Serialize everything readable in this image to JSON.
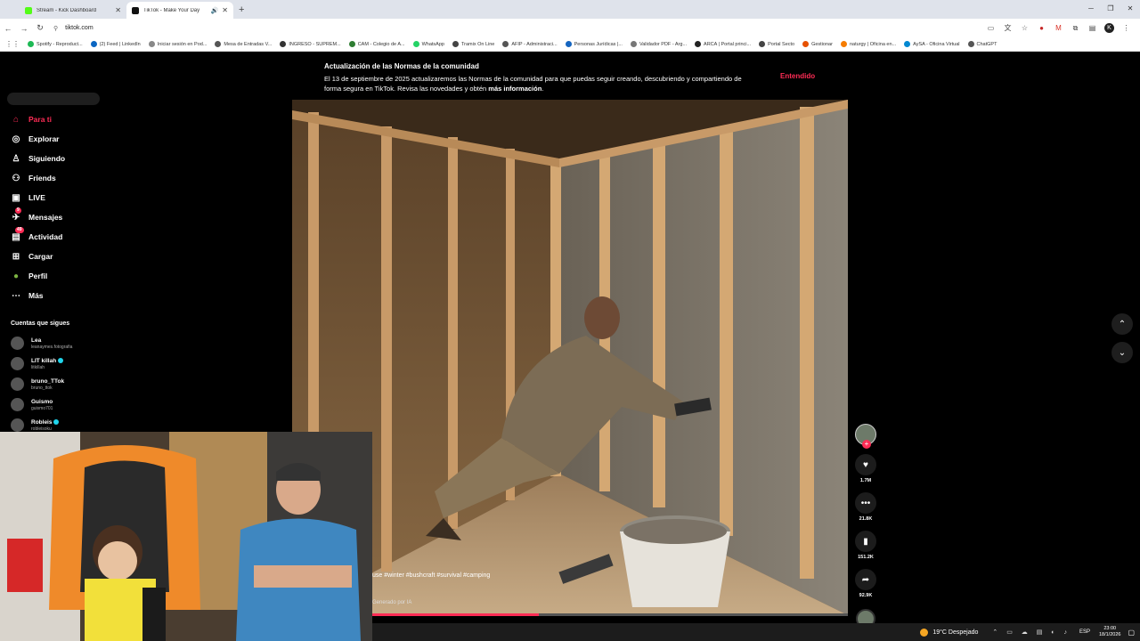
{
  "browser": {
    "tabs": [
      {
        "title": "Stream - Kick Dashboard",
        "active": false,
        "favicon_color": "#53fc18"
      },
      {
        "title": "TikTok - Make Your Day",
        "active": true,
        "favicon_color": "#111111"
      }
    ],
    "url": "tiktok.com",
    "bookmarks": [
      {
        "label": "Spotify - Reproduct...",
        "color": "#1db954"
      },
      {
        "label": "(2) Feed | LinkedIn",
        "color": "#0a66c2"
      },
      {
        "label": "Iniciar sesión en Pod...",
        "color": "#888888"
      },
      {
        "label": "Mesa de Entradas V...",
        "color": "#555555"
      },
      {
        "label": "INGRESO - SUPREM...",
        "color": "#333333"
      },
      {
        "label": "CAM - Colegio de A...",
        "color": "#2e7d32"
      },
      {
        "label": "WhatsApp",
        "color": "#25d366"
      },
      {
        "label": "Tramix On Line",
        "color": "#444444"
      },
      {
        "label": "AFIP - Administraci...",
        "color": "#555555"
      },
      {
        "label": "Personas Jurídicas |...",
        "color": "#1565c0"
      },
      {
        "label": "Validador PDF - Arg...",
        "color": "#777777"
      },
      {
        "label": "ARCA | Portal princi...",
        "color": "#222222"
      },
      {
        "label": "Portal Secto",
        "color": "#444444"
      },
      {
        "label": "Gestionar",
        "color": "#e65100"
      },
      {
        "label": "naturgy | Oficina en...",
        "color": "#f57c00"
      },
      {
        "label": "AySA - Oficina Virtual",
        "color": "#0288d1"
      },
      {
        "label": "ChatGPT",
        "color": "#555555"
      }
    ]
  },
  "sidebar": {
    "items": [
      {
        "label": "Para ti",
        "icon": "home-icon",
        "active": true
      },
      {
        "label": "Explorar",
        "icon": "compass-icon",
        "active": false
      },
      {
        "label": "Siguiendo",
        "icon": "following-icon",
        "active": false
      },
      {
        "label": "Friends",
        "icon": "friends-icon",
        "active": false
      },
      {
        "label": "LIVE",
        "icon": "live-icon",
        "active": false
      },
      {
        "label": "Mensajes",
        "icon": "messages-icon",
        "active": false,
        "badge": "9"
      },
      {
        "label": "Actividad",
        "icon": "activity-icon",
        "active": false,
        "badge": "49"
      },
      {
        "label": "Cargar",
        "icon": "upload-icon",
        "active": false
      },
      {
        "label": "Perfil",
        "icon": "profile-icon",
        "active": false
      },
      {
        "label": "Más",
        "icon": "more-icon",
        "active": false
      }
    ],
    "following_title": "Cuentas que sigues",
    "following": [
      {
        "name": "Lea",
        "handle": "leanaymes.fotografia",
        "verified": false
      },
      {
        "name": "LIT killah",
        "handle": "litkillah",
        "verified": true
      },
      {
        "name": "bruno_TTok",
        "handle": "bruno_ttok",
        "verified": false
      },
      {
        "name": "Guismo",
        "handle": "guismo701",
        "verified": false
      },
      {
        "name": "Robleis",
        "handle": "robleisoku",
        "verified": true
      }
    ]
  },
  "banner": {
    "title": "Actualización de las Normas de la comunidad",
    "body": "El 13 de septiembre de 2025 actualizaremos las Normas de la comunidad para que puedas seguir creando, descubriendo y compartiendo de forma segura en TikTok. Revisa las novedades y obtén",
    "link": "más información",
    "button": "Entendido"
  },
  "video": {
    "caption": "use #winter #bushcraft #survival #camping",
    "ai_label": "Generado por IA",
    "progress": 0.35
  },
  "actions": {
    "likes": "1.7M",
    "comments": "21.8K",
    "saves": "151.2K",
    "shares": "92.9K"
  },
  "taskbar": {
    "weather": "19°C  Despejado",
    "lang": "ESP",
    "time": "23:00",
    "date": "18/1/2026"
  }
}
